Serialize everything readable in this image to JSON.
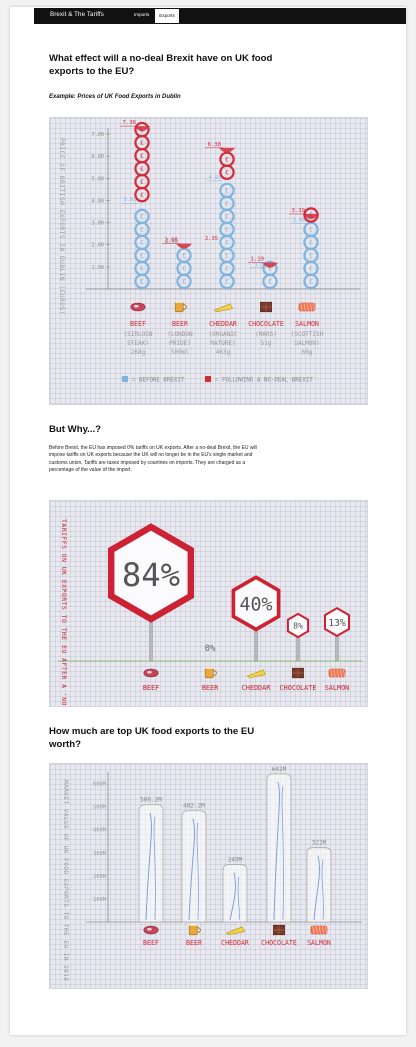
{
  "header": {
    "brand": "Brexit & The Tariffs",
    "nav": [
      "Imports",
      "Exports"
    ]
  },
  "section1": {
    "title": "What effect will a no-deal Brexit have on UK food exports to the EU?",
    "subtitle": "Example: Prices of UK Food Exports in Dublin"
  },
  "section2": {
    "title": "But Why...?",
    "paragraph": "Before Brexit, the EU has imposed 0% tariffs on UK exports. After a no-deal Brexit, the EU will impose tariffs on UK exports because the UK will no longer be in the EU's single market and customs union. Tariffs are taxes imposed by countries on imports. They are charged as a percentage of the value of the import."
  },
  "section3": {
    "title": "How much are top UK food exports to the EU worth?"
  },
  "colors": {
    "before": "#7fb4e0",
    "after": "#d42a3a",
    "ink": "#8a8a8a",
    "sign": "#cc2233"
  },
  "chart_data": [
    {
      "type": "bar",
      "ylabel": "PRICE OF BRITISH EXPORTS IN DUBLIN (EUROS)",
      "ylim": [
        0,
        7.5
      ],
      "ytick_labels": [
        "1.00",
        "2.00",
        "3.00",
        "4.00",
        "5.00",
        "6.00",
        "7.00"
      ],
      "categories": [
        {
          "name": "BEEF",
          "detail": [
            "(SIRLOIN",
            "STEAK)",
            "268g"
          ]
        },
        {
          "name": "BEER",
          "detail": [
            "(LONDON",
            "PRIDE)",
            "500ml"
          ]
        },
        {
          "name": "CHEDDAR",
          "detail": [
            "(ORGANIC",
            "MATURE)",
            "463g"
          ]
        },
        {
          "name": "CHOCOLATE",
          "detail": [
            "(MARS)",
            "51g"
          ]
        },
        {
          "name": "SALMON",
          "detail": [
            "(SCOTTISH",
            "SALMON)",
            "60g"
          ]
        }
      ],
      "series": [
        {
          "name": "= BEFORE BREXIT",
          "values": [
            3.92,
            2.05,
            4.93,
            1.0,
            3.0
          ],
          "labels": [
            "3.92",
            "2.05",
            "4.93",
            "1.0",
            "3.00"
          ]
        },
        {
          "name": "= FOLLOWING A NO-DEAL BREXIT",
          "values": [
            7.36,
            2.05,
            6.38,
            1.19,
            3.39
          ],
          "labels": [
            "7.36",
            "2.05",
            "6.38",
            "1.19",
            "3.39"
          ]
        }
      ],
      "after_value_labels": [
        "7.36",
        "",
        "6.38",
        "1.19",
        "3.39"
      ],
      "extra_labels": [
        "2.35"
      ]
    },
    {
      "type": "bar",
      "ylabel": "TARIFFS ON UK EXPORTS TO THE EU AFTER A 'NO-DEAL' BREXIT",
      "categories": [
        "BEEF",
        "BEER",
        "CHEDDAR",
        "CHOCOLATE",
        "SALMON"
      ],
      "values": [
        84,
        0,
        40,
        8,
        13
      ],
      "labels": [
        "84%",
        "0%",
        "40%",
        "8%",
        "13%"
      ]
    },
    {
      "type": "bar",
      "ylabel": "MARKET VALUE OF UK FOOD EXPORTS TO THE EU IN 2018",
      "ylim": [
        0,
        650
      ],
      "ytick_labels": [
        "100M",
        "200M",
        "300M",
        "400M",
        "500M",
        "600M"
      ],
      "categories": [
        "BEEF",
        "BEER",
        "CHEDDAR",
        "CHOCOLATE",
        "SALMON"
      ],
      "values": [
        508.2,
        482.2,
        249,
        642,
        322
      ],
      "labels": [
        "508.2M",
        "482.2M",
        "249M",
        "642M",
        "322M"
      ]
    }
  ]
}
